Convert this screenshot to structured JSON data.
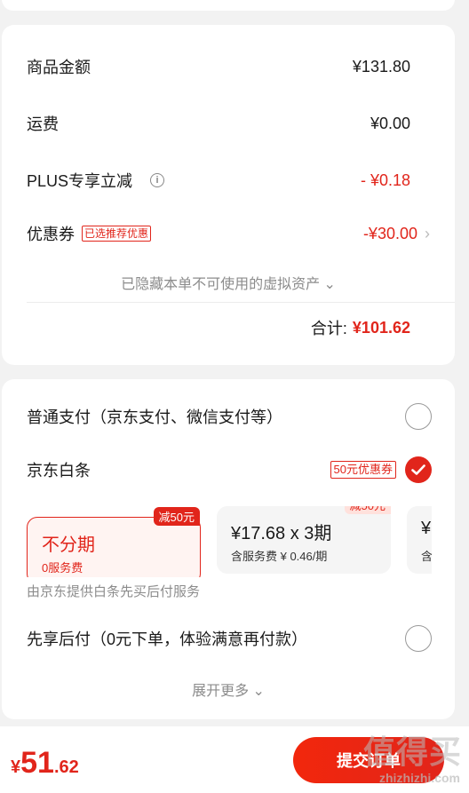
{
  "summary": {
    "goods_label": "商品金额",
    "goods_value": "¥131.80",
    "shipping_label": "运费",
    "shipping_value": "¥0.00",
    "plus_label": "PLUS专享立减",
    "plus_value": "- ¥0.18",
    "coupon_label": "优惠券",
    "coupon_tag": "已选推荐优惠",
    "coupon_value": "-¥30.00",
    "hidden_note": "已隐藏本单不可使用的虚拟资产",
    "total_label": "合计:",
    "total_value": "¥101.62"
  },
  "payment": {
    "normal_label": "普通支付（京东支付、微信支付等）",
    "baitiao_label": "京东白条",
    "baitiao_tag": "50元优惠券",
    "plans": [
      {
        "badge": "减50元",
        "title": "不分期",
        "sub": "0服务费",
        "selected": true
      },
      {
        "badge": "减50元",
        "title": "¥17.68 x 3期",
        "sub": "含服务费 ¥ 0.46/期",
        "selected": false
      },
      {
        "title": "¥",
        "sub": "含",
        "selected": false
      }
    ],
    "note": "由京东提供白条先买后付服务",
    "later_label": "先享后付（0元下单，体验满意再付款）",
    "more_label": "展开更多"
  },
  "footer": {
    "currency": "¥",
    "price_int": "51",
    "price_dec": ".62",
    "submit_label": "提交订单",
    "watermark": "值得买",
    "watermark_sub": "zhizhizhi.com"
  },
  "colors": {
    "accent": "#e1251b"
  }
}
